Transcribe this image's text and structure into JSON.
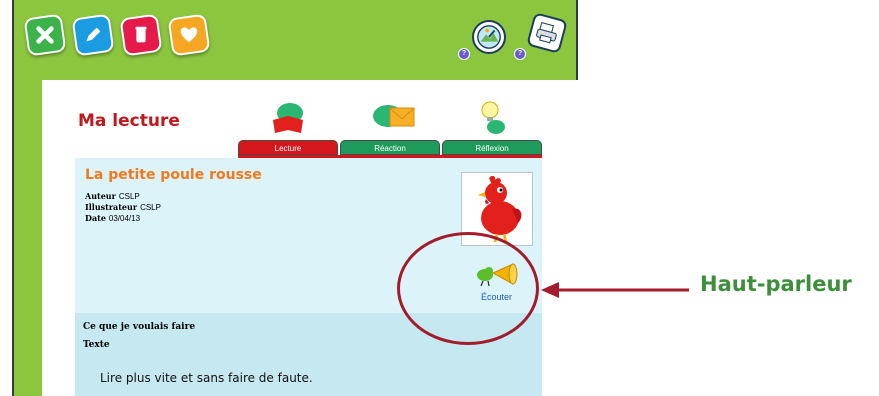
{
  "toolbar": {
    "icons": [
      "close-icon",
      "pencil-icon",
      "trash-icon",
      "heart-icon"
    ],
    "right_icons": [
      "dashboard-icon",
      "print-icon"
    ],
    "help_label": "?"
  },
  "tabs": [
    {
      "label": "Lecture",
      "icon": "book-icon",
      "active": true
    },
    {
      "label": "Réaction",
      "icon": "envelope-icon",
      "active": false
    },
    {
      "label": "Réflexion",
      "icon": "lightbulb-icon",
      "active": false
    }
  ],
  "page": {
    "title": "Ma lecture"
  },
  "book": {
    "title": "La petite poule rousse",
    "author_label": "Auteur",
    "author": "CSLP",
    "illustrator_label": "Illustrateur",
    "illustrator": "CSLP",
    "date_label": "Date",
    "date": "03/04/13",
    "listen_label": "Écouter"
  },
  "notes": {
    "heading": "Ce que je voulais faire",
    "subheading": "Texte",
    "text": "Lire plus vite et sans faire de faute."
  },
  "annotation": {
    "label": "Haut-parleur"
  },
  "colors": {
    "frame_green": "#8cc63f",
    "active_tab": "#d4171d",
    "inactive_tab": "#1e9b5a",
    "title_red": "#c0181e",
    "book_title_orange": "#f07a1e",
    "callout_red": "#a31c2b",
    "label_green": "#3e8f3b"
  }
}
